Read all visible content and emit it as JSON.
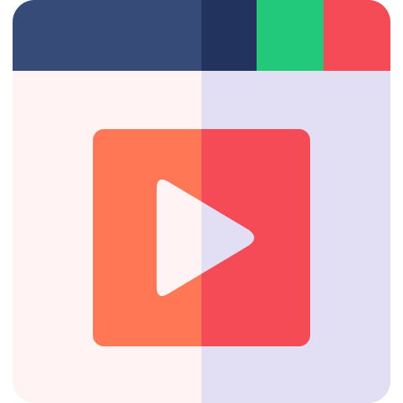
{
  "colors": {
    "titlebar_left": "#374b78",
    "titlebar_right": "#22335d",
    "green_button": "#22c97a",
    "red_button": "#f44b56",
    "body_left": "#fff4f3",
    "body_right": "#e2def4",
    "play_tile_left": "#ff7755",
    "play_tile_right": "#f44b56",
    "play_glyph_left": "#fff4f3",
    "play_glyph_right": "#e2def4"
  },
  "icons": {
    "window": "browser-window-icon",
    "play": "play-icon"
  }
}
